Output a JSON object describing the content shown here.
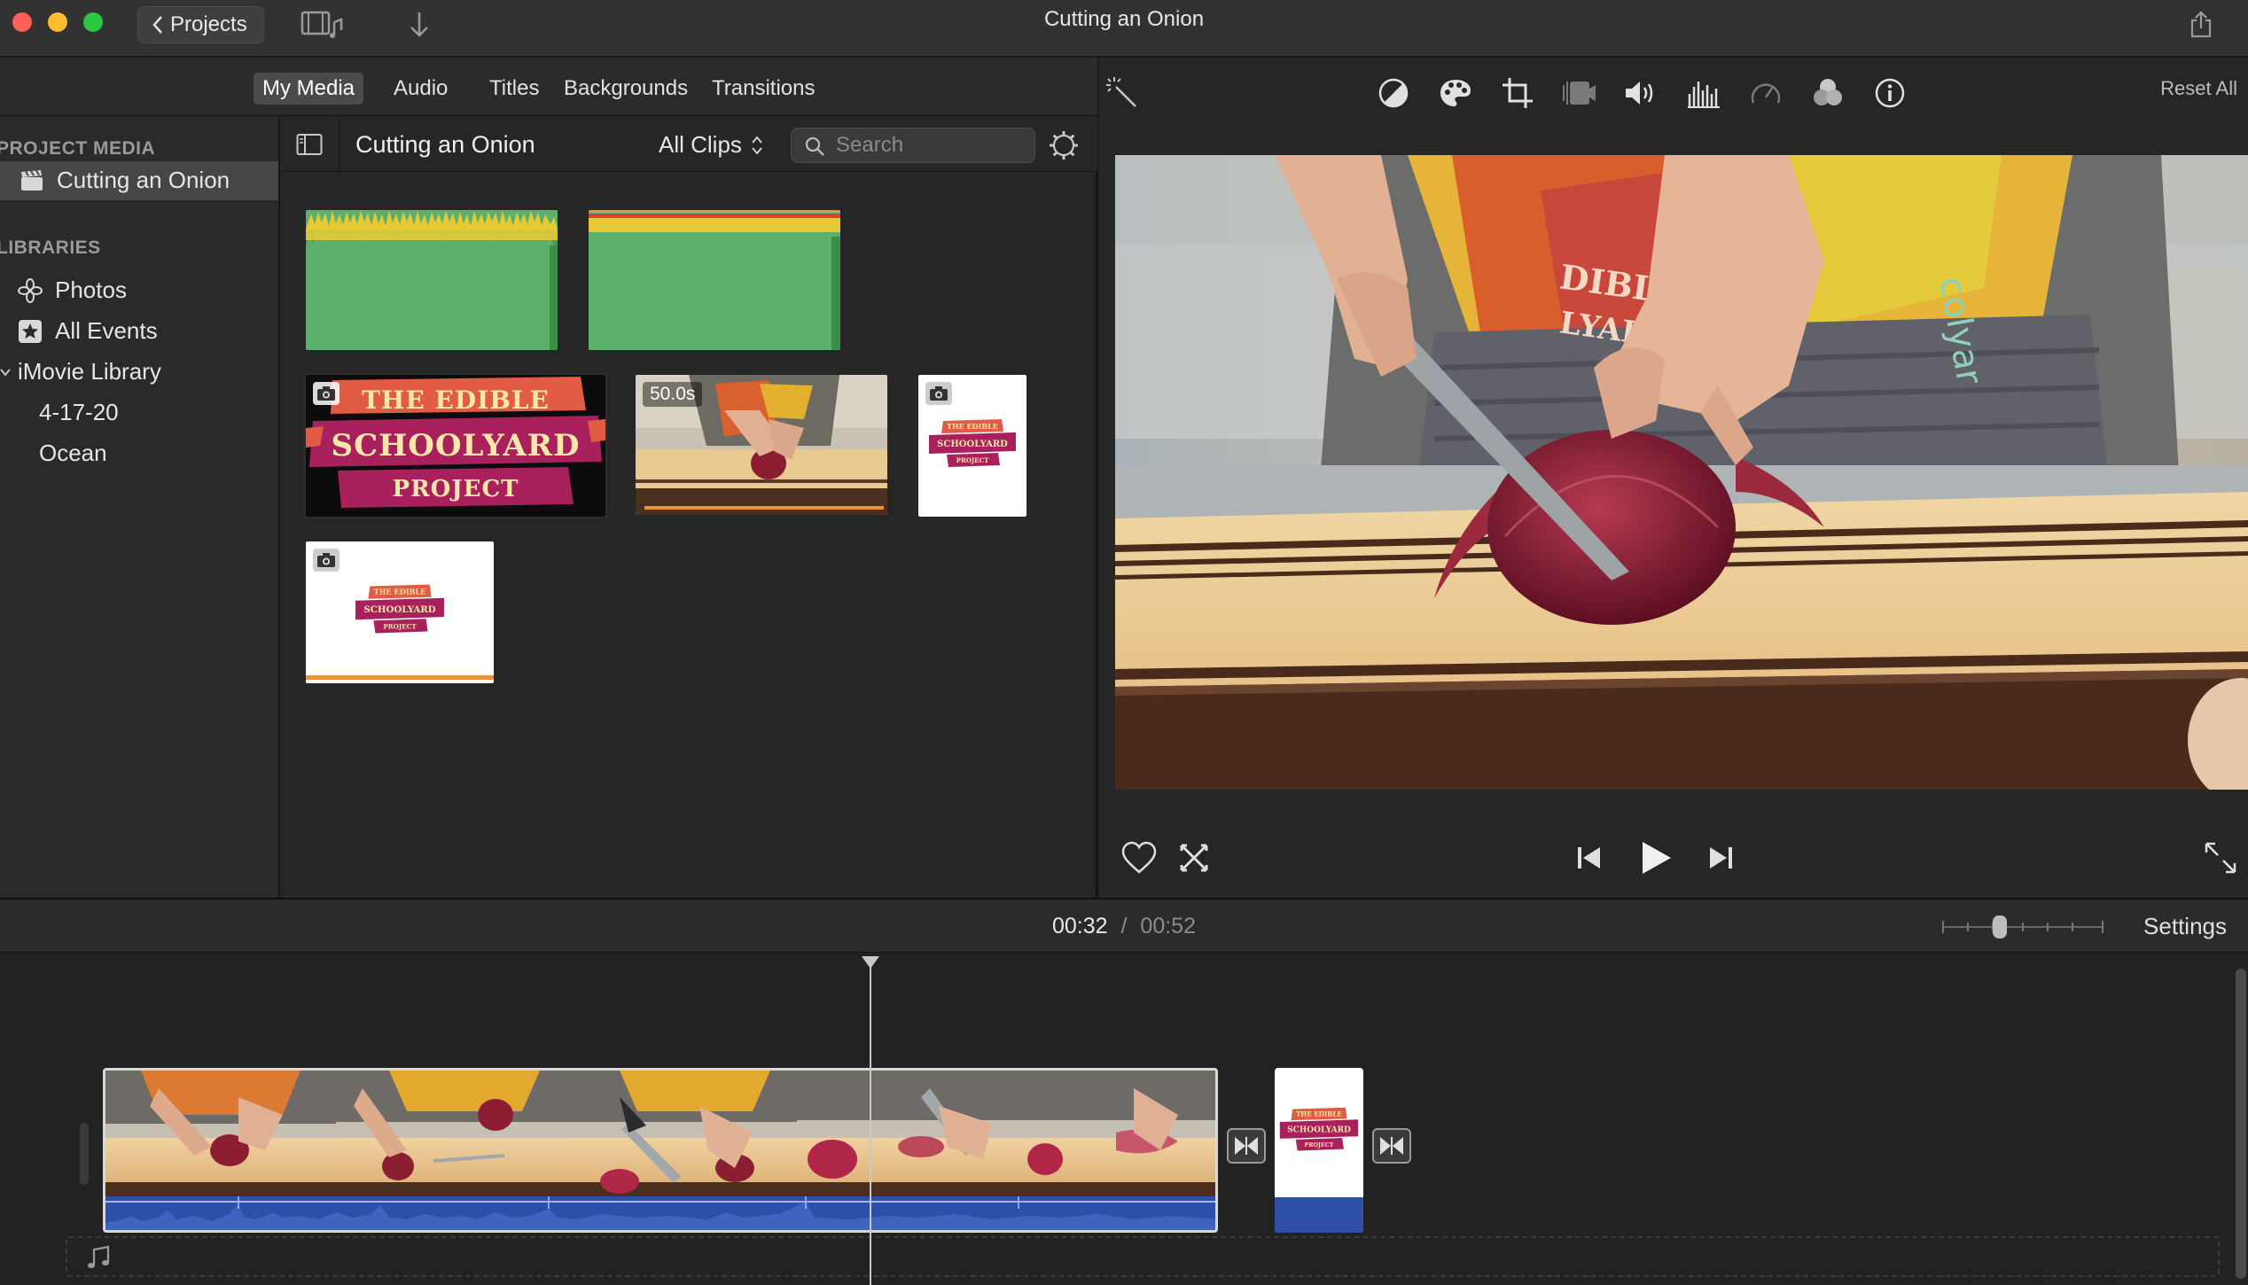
{
  "window": {
    "title": "Cutting an Onion"
  },
  "toolbar": {
    "projects_label": "Projects"
  },
  "tabs": [
    {
      "label": "My Media",
      "active": true
    },
    {
      "label": "Audio",
      "active": false
    },
    {
      "label": "Titles",
      "active": false
    },
    {
      "label": "Backgrounds",
      "active": false
    },
    {
      "label": "Transitions",
      "active": false
    }
  ],
  "sidebar": {
    "project_media_header": "PROJECT MEDIA",
    "project_item": "Cutting an Onion",
    "libraries_header": "LIBRARIES",
    "photos": "Photos",
    "all_events": "All Events",
    "library": "iMovie Library",
    "events": [
      "4-17-20",
      "Ocean"
    ]
  },
  "media": {
    "title": "Cutting an Onion",
    "filter": "All Clips",
    "search_placeholder": "Search",
    "clip_duration": "50.0s",
    "banner_line1": "THE EDIBLE",
    "banner_line2": "SCHOOLYARD",
    "banner_line3": "PROJECT"
  },
  "viewer": {
    "reset_all": "Reset All",
    "apron_text_1": "DIBLE",
    "apron_text_2": "LYARD",
    "shirt_text": "colyar"
  },
  "timeline": {
    "current_time": "00:32",
    "separator": "/",
    "total_time": "00:52",
    "settings_label": "Settings"
  },
  "colors": {
    "accent_orange": "#e8943a",
    "audio_green": "#5bb16c",
    "audio_blue": "#2d4fa7",
    "banner_magenta": "#a8215d",
    "banner_orange": "#e25b45"
  }
}
